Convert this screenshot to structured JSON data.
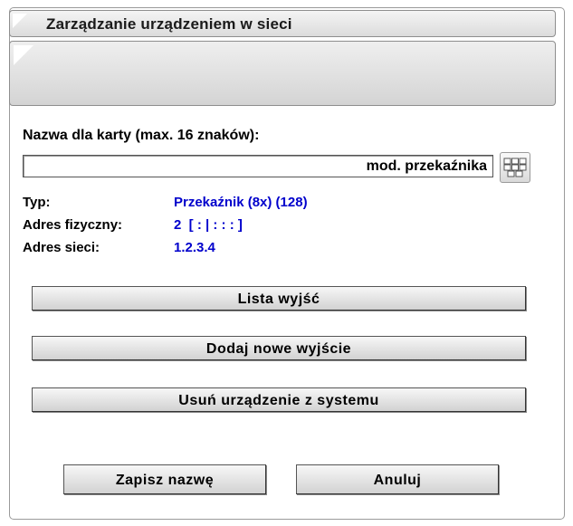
{
  "window": {
    "title": "Zarządzanie urządzeniem w sieci"
  },
  "form": {
    "name_label": "Nazwa dla karty (max. 16 znaków):",
    "name_value": "mod. przekaźnika",
    "keyboard_icon": "keyboard-icon"
  },
  "info": {
    "type_label": "Typ:",
    "type_value": "Przekaźnik (8x) (128)",
    "physical_label": "Adres fizyczny:",
    "physical_value": "2  [ : | : : : ]",
    "network_label": "Adres sieci:",
    "network_value": "1.2.3.4",
    "value_color": "#0000cc"
  },
  "actions": {
    "list_outputs": "Lista wyjść",
    "add_output": "Dodaj nowe wyjście",
    "remove_device": "Usuń urządzenie z systemu"
  },
  "footer": {
    "save": "Zapisz nazwę",
    "cancel": "Anuluj"
  }
}
